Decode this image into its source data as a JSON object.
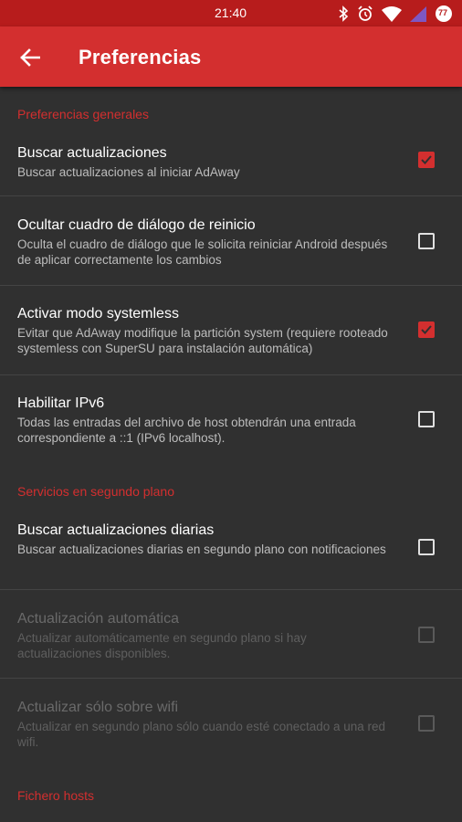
{
  "status_bar": {
    "time": "21:40",
    "icons": [
      "bluetooth-icon",
      "alarm-icon",
      "wifi-icon",
      "signal-icon",
      "battery-icon"
    ],
    "battery_level": "77"
  },
  "toolbar": {
    "title": "Preferencias",
    "back_icon": "arrow-back-icon",
    "color": "#d32f2f"
  },
  "sections": [
    {
      "header": "Preferencias generales",
      "items": [
        {
          "title": "Buscar actualizaciones",
          "summary": "Buscar actualizaciones al iniciar AdAway",
          "checked": true,
          "enabled": true
        },
        {
          "title": "Ocultar cuadro de diálogo de reinicio",
          "summary": "Oculta el cuadro de diálogo que le solicita reiniciar Android después de aplicar correctamente los cambios",
          "checked": false,
          "enabled": true
        },
        {
          "title": "Activar modo systemless",
          "summary": "Evitar que AdAway modifique la partición system (requiere rooteado systemless con SuperSU para instalación automática)",
          "checked": true,
          "enabled": true
        },
        {
          "title": "Habilitar IPv6",
          "summary": "Todas las entradas del archivo de host obtendrán una entrada correspondiente a ::1 (IPv6 localhost).",
          "checked": false,
          "enabled": true
        }
      ]
    },
    {
      "header": "Servicios en segundo plano",
      "items": [
        {
          "title": "Buscar actualizaciones diarias",
          "summary": "Buscar actualizaciones diarias en segundo plano con notificaciones",
          "checked": false,
          "enabled": true
        },
        {
          "title": "Actualización automática",
          "summary": "Actualizar automáticamente en segundo plano si hay actualizaciones disponibles.",
          "checked": false,
          "enabled": false
        },
        {
          "title": "Actualizar sólo sobre wifi",
          "summary": "Actualizar en segundo plano sólo cuando esté conectado a una red wifi.",
          "checked": false,
          "enabled": false
        }
      ]
    },
    {
      "header": "Fichero hosts",
      "items": []
    }
  ]
}
